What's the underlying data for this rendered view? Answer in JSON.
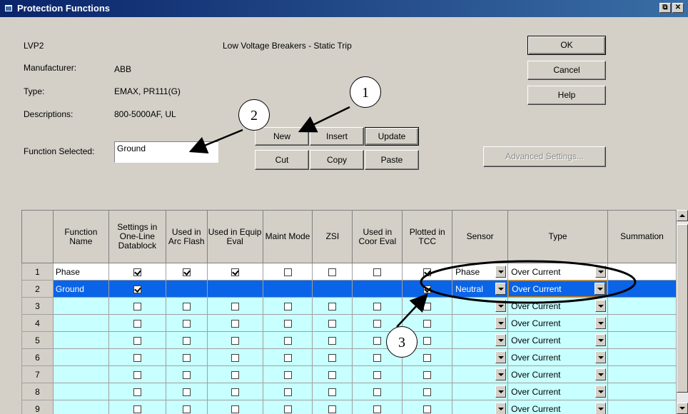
{
  "window": {
    "title": "Protection Functions",
    "restore_glyph": "⧉",
    "close_glyph": "✕"
  },
  "info": {
    "id": "LVP2",
    "category": "Low Voltage Breakers - Static Trip",
    "manufacturer_label": "Manufacturer:",
    "manufacturer": "ABB",
    "type_label": "Type:",
    "type": "EMAX, PR111(G)",
    "descriptions_label": "Descriptions:",
    "descriptions": "800-5000AF, UL",
    "function_selected_label": "Function Selected:",
    "function_selected": "Ground"
  },
  "buttons": {
    "ok": "OK",
    "cancel": "Cancel",
    "help": "Help",
    "new": "New",
    "insert": "Insert",
    "update": "Update",
    "cut": "Cut",
    "copy": "Copy",
    "paste": "Paste",
    "advanced": "Advanced Settings..."
  },
  "callouts": {
    "c1": "1",
    "c2": "2",
    "c3": "3"
  },
  "grid": {
    "headers": {
      "name": "Function Name",
      "settings": "Settings in One-Line Datablock",
      "arc": "Used in Arc Flash",
      "equip": "Used in Equip Eval",
      "maint": "Maint Mode",
      "zsi": "ZSI",
      "coor": "Used in Coor Eval",
      "tcc": "Plotted in TCC",
      "sensor": "Sensor",
      "type": "Type",
      "summation": "Summation"
    },
    "rows": [
      {
        "num": "1",
        "name": "Phase",
        "settings": true,
        "arc": true,
        "equip": true,
        "maint": false,
        "zsi": false,
        "coor": false,
        "tcc": true,
        "sensor": "Phase",
        "type": "Over Current"
      },
      {
        "num": "2",
        "name": "Ground",
        "settings": true,
        "tcc": true,
        "sensor": "Neutral",
        "type": "Over Current"
      },
      {
        "num": "3",
        "name": "",
        "type": "Over Current"
      },
      {
        "num": "4",
        "name": "",
        "type": "Over Current"
      },
      {
        "num": "5",
        "name": "",
        "type": "Over Current"
      },
      {
        "num": "6",
        "name": "",
        "type": "Over Current"
      },
      {
        "num": "7",
        "name": "",
        "type": "Over Current"
      },
      {
        "num": "8",
        "name": "",
        "type": "Over Current"
      },
      {
        "num": "9",
        "name": "",
        "type": "Over Current"
      }
    ]
  }
}
